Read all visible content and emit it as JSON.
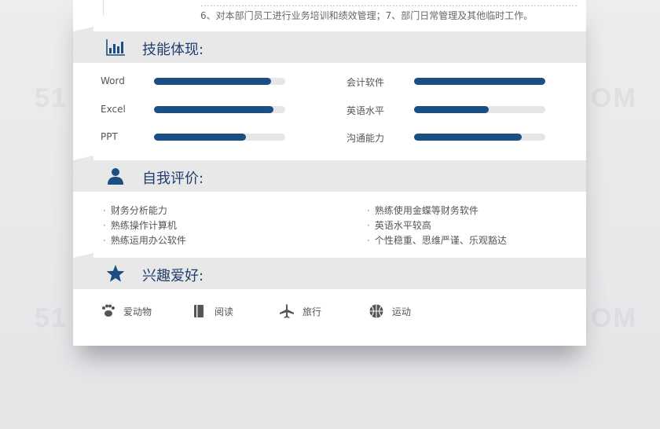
{
  "top_lines": {
    "line1": "…………………………………………………………………………………………………………",
    "line2": "6、对本部门员工进行业务培训和绩效管理；7、部门日常管理及其他临时工作。"
  },
  "watermark": {
    "left": "51",
    "right": "OM"
  },
  "skills": {
    "title": "技能体现:",
    "icon": "bar-chart-icon",
    "items": [
      {
        "label": "Word",
        "level": 0.89
      },
      {
        "label": "会计软件",
        "level": 1.0
      },
      {
        "label": "Excel",
        "level": 0.91
      },
      {
        "label": "英语水平",
        "level": 0.57
      },
      {
        "label": "PPT",
        "level": 0.7
      },
      {
        "label": "沟通能力",
        "level": 0.82
      }
    ]
  },
  "self_eval": {
    "title": "自我评价:",
    "icon": "user-icon",
    "left": [
      "财务分析能力",
      "熟练操作计算机",
      "熟练运用办公软件"
    ],
    "right": [
      "熟练使用金蝶等财务软件",
      "英语水平较高",
      "个性稳重、思维严谨、乐观豁达"
    ]
  },
  "hobbies": {
    "title": "兴趣爱好:",
    "icon": "star-icon",
    "items": [
      {
        "label": "爱动物",
        "icon": "paw-icon"
      },
      {
        "label": "阅读",
        "icon": "book-icon"
      },
      {
        "label": "旅行",
        "icon": "airplane-icon"
      },
      {
        "label": "运动",
        "icon": "basketball-icon"
      }
    ]
  },
  "colors": {
    "accent": "#1b4f84",
    "title": "#1e3f6e",
    "section_bg": "#e8e8e8",
    "track": "#e6e6e6"
  }
}
